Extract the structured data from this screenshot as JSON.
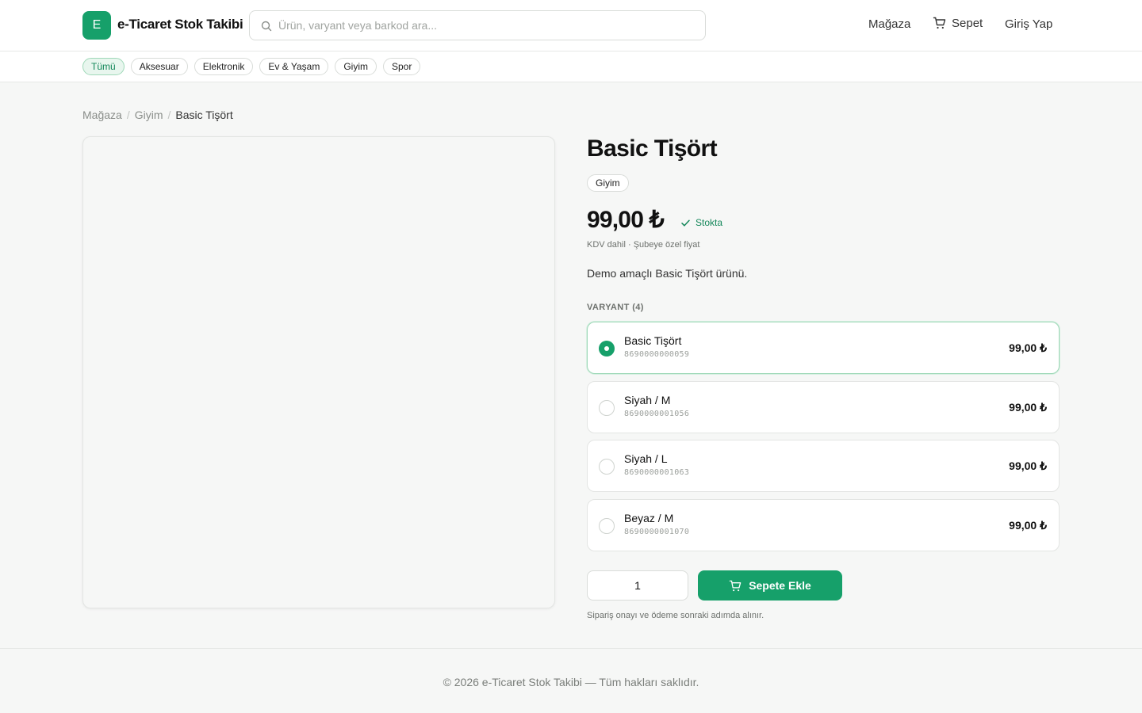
{
  "brand": {
    "logo_letter": "E",
    "name": "e-Ticaret Stok Takibi",
    "accent_color": "#16a06a"
  },
  "search": {
    "placeholder": "Ürün, varyant veya barkod ara..."
  },
  "nav": {
    "store": "Mağaza",
    "cart": "Sepet",
    "login": "Giriş Yap"
  },
  "categories": [
    {
      "label": "Tümü",
      "active": true
    },
    {
      "label": "Aksesuar"
    },
    {
      "label": "Elektronik"
    },
    {
      "label": "Ev & Yaşam"
    },
    {
      "label": "Giyim"
    },
    {
      "label": "Spor"
    }
  ],
  "breadcrumb": {
    "store": "Mağaza",
    "category": "Giyim",
    "current": "Basic Tişört"
  },
  "product": {
    "title": "Basic Tişört",
    "category_tag": "Giyim",
    "price": "99,00 ₺",
    "stock_status": "Stokta",
    "price_note": "KDV dahil · Şubeye özel fiyat",
    "description": "Demo amaçlı Basic Tişört ürünü."
  },
  "variants": {
    "heading": "VARYANT (4)",
    "items": [
      {
        "name": "Basic Tişört",
        "barcode": "8690000000059",
        "price": "99,00 ₺",
        "selected": true
      },
      {
        "name": "Siyah / M",
        "barcode": "8690000001056",
        "price": "99,00 ₺",
        "selected": false
      },
      {
        "name": "Siyah / L",
        "barcode": "8690000001063",
        "price": "99,00 ₺",
        "selected": false
      },
      {
        "name": "Beyaz / M",
        "barcode": "8690000001070",
        "price": "99,00 ₺",
        "selected": false
      }
    ]
  },
  "purchase": {
    "quantity": "1",
    "add_to_cart": "Sepete Ekle",
    "note": "Sipariş onayı ve ödeme sonraki adımda alınır."
  },
  "footer": {
    "text": "© 2026 e-Ticaret Stok Takibi — Tüm hakları saklıdır."
  }
}
